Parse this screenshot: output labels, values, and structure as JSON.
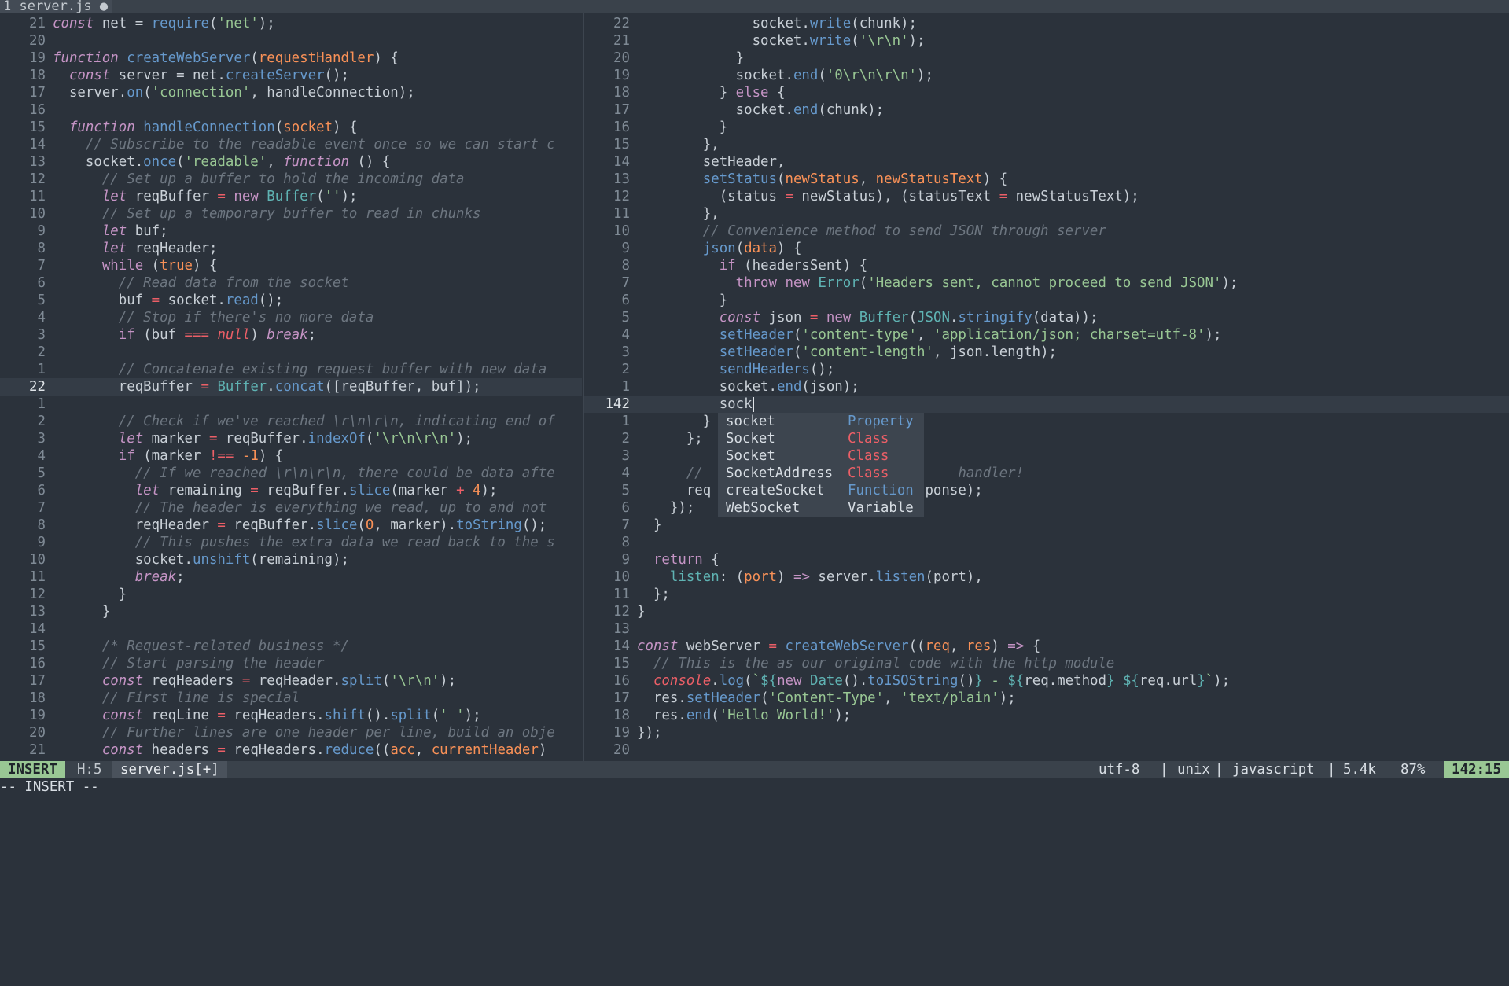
{
  "tab": {
    "label": "1 server.js ●"
  },
  "left_lines": [
    {
      "n": "21",
      "h": "<span class=\"k\">const</span> net = <span class=\"f\">require</span>(<span class=\"s\">'net'</span>);"
    },
    {
      "n": "20",
      "h": ""
    },
    {
      "n": "19",
      "h": "<span class=\"k\">function</span> <span class=\"f\">createWebServer</span>(<span class=\"p\">requestHandler</span>) {"
    },
    {
      "n": "18",
      "h": "  <span class=\"k\">const</span> server = net.<span class=\"f\">createServer</span>();"
    },
    {
      "n": "17",
      "h": "  server.<span class=\"f\">on</span>(<span class=\"s\">'connection'</span>, handleConnection);"
    },
    {
      "n": "16",
      "h": ""
    },
    {
      "n": "15",
      "h": "  <span class=\"k\">function</span> <span class=\"f\">handleConnection</span>(<span class=\"p\">socket</span>) {"
    },
    {
      "n": "14",
      "h": "    <span class=\"c\">// Subscribe to the readable event once so we can start c</span>"
    },
    {
      "n": "13",
      "h": "    socket.<span class=\"f\">once</span>(<span class=\"s\">'readable'</span>, <span class=\"k\">function</span> () {"
    },
    {
      "n": "12",
      "h": "      <span class=\"c\">// Set up a buffer to hold the incoming data</span>"
    },
    {
      "n": "11",
      "h": "      <span class=\"k\">let</span> reqBuffer <span class=\"o\">=</span> <span class=\"kw\">new</span> <span class=\"t\">Buffer</span>(<span class=\"s\">''</span>);"
    },
    {
      "n": "10",
      "h": "      <span class=\"c\">// Set up a temporary buffer to read in chunks</span>"
    },
    {
      "n": "9",
      "h": "      <span class=\"k\">let</span> buf;"
    },
    {
      "n": "8",
      "h": "      <span class=\"k\">let</span> reqHeader;"
    },
    {
      "n": "7",
      "h": "      <span class=\"kw\">while</span> (<span class=\"n\">true</span>) {"
    },
    {
      "n": "6",
      "h": "        <span class=\"c\">// Read data from the socket</span>"
    },
    {
      "n": "5",
      "h": "        buf <span class=\"o\">=</span> socket.<span class=\"f\">read</span>();"
    },
    {
      "n": "4",
      "h": "        <span class=\"c\">// Stop if there's no more data</span>"
    },
    {
      "n": "3",
      "h": "        <span class=\"kw\">if</span> (buf <span class=\"o\">===</span> <span class=\"r\">null</span>) <span class=\"k\">break</span>;"
    },
    {
      "n": "2",
      "h": ""
    },
    {
      "n": "1",
      "h": "        <span class=\"c\">// Concatenate existing request buffer with new data</span>"
    },
    {
      "n": "22",
      "h": "        reqBuffer <span class=\"o\">=</span> <span class=\"t\">Buffer</span>.<span class=\"f\">concat</span>([reqBuffer, buf]);",
      "cur": true
    },
    {
      "n": "1",
      "h": ""
    },
    {
      "n": "2",
      "h": "        <span class=\"c\">// Check if we've reached \\r\\n\\r\\n, indicating end of</span>"
    },
    {
      "n": "3",
      "h": "        <span class=\"k\">let</span> marker <span class=\"o\">=</span> reqBuffer.<span class=\"f\">indexOf</span>(<span class=\"s\">'\\r\\n\\r\\n'</span>);"
    },
    {
      "n": "4",
      "h": "        <span class=\"kw\">if</span> (marker <span class=\"o\">!==</span> <span class=\"n\">-1</span>) {"
    },
    {
      "n": "5",
      "h": "          <span class=\"c\">// If we reached \\r\\n\\r\\n, there could be data afte</span>"
    },
    {
      "n": "6",
      "h": "          <span class=\"k\">let</span> remaining <span class=\"o\">=</span> reqBuffer.<span class=\"f\">slice</span>(marker <span class=\"o\">+</span> <span class=\"n\">4</span>);"
    },
    {
      "n": "7",
      "h": "          <span class=\"c\">// The header is everything we read, up to and not</span>"
    },
    {
      "n": "8",
      "h": "          reqHeader <span class=\"o\">=</span> reqBuffer.<span class=\"f\">slice</span>(<span class=\"n\">0</span>, marker).<span class=\"f\">toString</span>();"
    },
    {
      "n": "9",
      "h": "          <span class=\"c\">// This pushes the extra data we read back to the s</span>"
    },
    {
      "n": "10",
      "h": "          socket.<span class=\"f\">unshift</span>(remaining);"
    },
    {
      "n": "11",
      "h": "          <span class=\"k\">break</span>;"
    },
    {
      "n": "12",
      "h": "        }"
    },
    {
      "n": "13",
      "h": "      }"
    },
    {
      "n": "14",
      "h": ""
    },
    {
      "n": "15",
      "h": "      <span class=\"c\">/* Request-related business */</span>"
    },
    {
      "n": "16",
      "h": "      <span class=\"c\">// Start parsing the header</span>"
    },
    {
      "n": "17",
      "h": "      <span class=\"k\">const</span> reqHeaders <span class=\"o\">=</span> reqHeader.<span class=\"f\">split</span>(<span class=\"s\">'\\r\\n'</span>);"
    },
    {
      "n": "18",
      "h": "      <span class=\"c\">// First line is special</span>"
    },
    {
      "n": "19",
      "h": "      <span class=\"k\">const</span> reqLine <span class=\"o\">=</span> reqHeaders.<span class=\"f\">shift</span>().<span class=\"f\">split</span>(<span class=\"s\">' '</span>);"
    },
    {
      "n": "20",
      "h": "      <span class=\"c\">// Further lines are one header per line, build an obje</span>"
    },
    {
      "n": "21",
      "h": "      <span class=\"k\">const</span> headers <span class=\"o\">=</span> reqHeaders.<span class=\"f\">reduce</span>((<span class=\"p\">acc</span>, <span class=\"p\">currentHeader</span>)"
    }
  ],
  "right_lines": [
    {
      "n": "22",
      "h": "              socket.<span class=\"f\">write</span>(chunk);"
    },
    {
      "n": "21",
      "h": "              socket.<span class=\"f\">write</span>(<span class=\"s\">'\\r\\n'</span>);"
    },
    {
      "n": "20",
      "h": "            }"
    },
    {
      "n": "19",
      "h": "            socket.<span class=\"f\">end</span>(<span class=\"s\">'0\\r\\n\\r\\n'</span>);"
    },
    {
      "n": "18",
      "h": "          } <span class=\"kw\">else</span> {"
    },
    {
      "n": "17",
      "h": "            socket.<span class=\"f\">end</span>(chunk);"
    },
    {
      "n": "16",
      "h": "          }"
    },
    {
      "n": "15",
      "h": "        },"
    },
    {
      "n": "14",
      "h": "        setHeader,"
    },
    {
      "n": "13",
      "h": "        <span class=\"f\">setStatus</span>(<span class=\"p\">newStatus</span>, <span class=\"p\">newStatusText</span>) {"
    },
    {
      "n": "12",
      "h": "          (status <span class=\"o\">=</span> newStatus), (statusText <span class=\"o\">=</span> newStatusText);"
    },
    {
      "n": "11",
      "h": "        },"
    },
    {
      "n": "10",
      "h": "        <span class=\"c\">// Convenience method to send JSON through server</span>"
    },
    {
      "n": "9",
      "h": "        <span class=\"f\">json</span>(<span class=\"p\">data</span>) {"
    },
    {
      "n": "8",
      "h": "          <span class=\"kw\">if</span> (headersSent) {"
    },
    {
      "n": "7",
      "h": "            <span class=\"kw\">throw</span> <span class=\"kw\">new</span> <span class=\"t\">Error</span>(<span class=\"s\">'Headers sent, cannot proceed to send JSON'</span>);"
    },
    {
      "n": "6",
      "h": "          }"
    },
    {
      "n": "5",
      "h": "          <span class=\"k\">const</span> json <span class=\"o\">=</span> <span class=\"kw\">new</span> <span class=\"t\">Buffer</span>(<span class=\"t\">JSON</span>.<span class=\"f\">stringify</span>(data));"
    },
    {
      "n": "4",
      "h": "          <span class=\"f\">setHeader</span>(<span class=\"s\">'content-type'</span>, <span class=\"s\">'application/json; charset=utf-8'</span>);"
    },
    {
      "n": "3",
      "h": "          <span class=\"f\">setHeader</span>(<span class=\"s\">'content-length'</span>, json.length);"
    },
    {
      "n": "2",
      "h": "          <span class=\"f\">sendHeaders</span>();"
    },
    {
      "n": "1",
      "h": "          socket.<span class=\"f\">end</span>(json);"
    },
    {
      "n": "142",
      "h": "          sock<span class=\"caret\" data-name=\"text-cursor\" data-interactable=\"false\"></span>",
      "cur": true
    },
    {
      "n": "1",
      "h": "        }"
    },
    {
      "n": "2",
      "h": "      };"
    },
    {
      "n": "3",
      "h": ""
    },
    {
      "n": "4",
      "h": "      <span class=\"c\">//                               handler!</span>"
    },
    {
      "n": "5",
      "h": "      req                          ponse);"
    },
    {
      "n": "6",
      "h": "    });"
    },
    {
      "n": "7",
      "h": "  }"
    },
    {
      "n": "8",
      "h": ""
    },
    {
      "n": "9",
      "h": "  <span class=\"kw\">return</span> {"
    },
    {
      "n": "10",
      "h": "    <span class=\"t\">listen</span>: (<span class=\"p\">port</span>) <span class=\"k\">=&gt;</span> server.<span class=\"f\">listen</span>(port),"
    },
    {
      "n": "11",
      "h": "  };"
    },
    {
      "n": "12",
      "h": "}"
    },
    {
      "n": "13",
      "h": ""
    },
    {
      "n": "14",
      "h": "<span class=\"k\">const</span> webServer <span class=\"o\">=</span> <span class=\"f\">createWebServer</span>((<span class=\"p\">req</span>, <span class=\"p\">res</span>) <span class=\"k\">=&gt;</span> {"
    },
    {
      "n": "15",
      "h": "  <span class=\"c\">// This is the as our original code with the http module</span>"
    },
    {
      "n": "16",
      "h": "  <span class=\"r\">console</span>.<span class=\"f\">log</span>(<span class=\"s\">`</span><span class=\"t\">${</span><span class=\"kw\">new</span> <span class=\"t\">Date</span>().<span class=\"f\">toISOString</span>()<span class=\"t\">}</span><span class=\"s\"> - </span><span class=\"t\">${</span>req.method<span class=\"t\">}</span> <span class=\"t\">${</span>req.url<span class=\"t\">}</span><span class=\"s\">`</span>);"
    },
    {
      "n": "17",
      "h": "  res.<span class=\"f\">setHeader</span>(<span class=\"s\">'Content-Type'</span>, <span class=\"s\">'text/plain'</span>);"
    },
    {
      "n": "18",
      "h": "  res.<span class=\"f\">end</span>(<span class=\"s\">'Hello World!'</span>);"
    },
    {
      "n": "19",
      "h": "});"
    },
    {
      "n": "20",
      "h": ""
    }
  ],
  "completion": [
    {
      "word": "socket",
      "kind": "Property",
      "color": "#6699cc"
    },
    {
      "word": "Socket",
      "kind": "Class",
      "color": "#ec5f67"
    },
    {
      "word": "Socket",
      "kind": "Class",
      "color": "#ec5f67"
    },
    {
      "word": "SocketAddress",
      "kind": "Class",
      "color": "#ec5f67"
    },
    {
      "word": "createSocket",
      "kind": "Function",
      "color": "#6699cc"
    },
    {
      "word": "WebSocket",
      "kind": "Variable",
      "color": "#d8dee4"
    }
  ],
  "status": {
    "mode": "INSERT",
    "hcount": "H:5",
    "filename": "server.js[+]",
    "encoding": "utf-8",
    "sep1": "|",
    "fileformat": "unix",
    "sep2": "|",
    "filetype": "javascript",
    "sep3": "|",
    "size": "5.4k",
    "percent": "87%",
    "position": "142:15"
  },
  "cmdline": "-- INSERT --"
}
